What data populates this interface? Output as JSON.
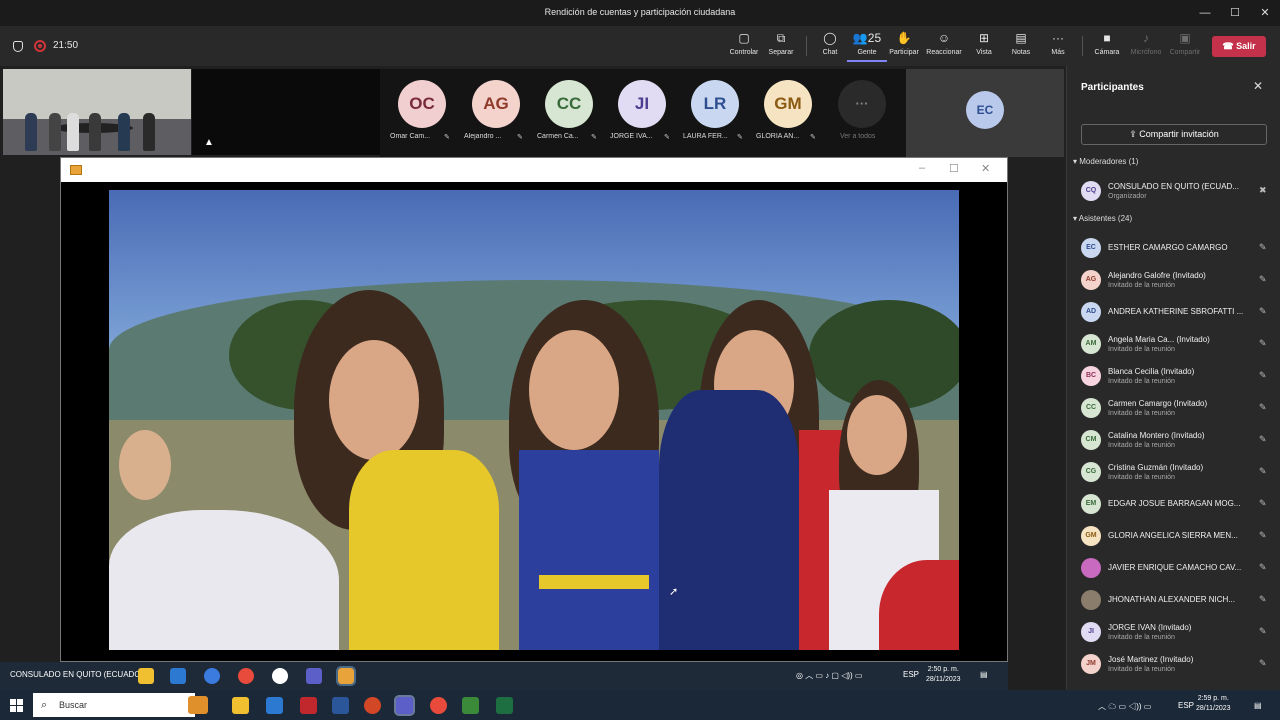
{
  "window": {
    "title": "Rendición de cuentas y participación ciudadana",
    "controls": [
      "—",
      "☐",
      "✕"
    ]
  },
  "meeting": {
    "timer": "21:50",
    "toolbar": [
      {
        "id": "controlar",
        "icon": "▢",
        "label": "Controlar"
      },
      {
        "id": "separar",
        "icon": "⧉",
        "label": "Separar"
      },
      {
        "id": "chat",
        "icon": "◯",
        "label": "Chat"
      },
      {
        "id": "gente",
        "icon": "👥25",
        "label": "Gente"
      },
      {
        "id": "participar",
        "icon": "✋",
        "label": "Participar"
      },
      {
        "id": "reaccionar",
        "icon": "☺",
        "label": "Reaccionar"
      },
      {
        "id": "vista",
        "icon": "⊞",
        "label": "Vista"
      },
      {
        "id": "notas",
        "icon": "▤",
        "label": "Notas"
      },
      {
        "id": "mas",
        "icon": "···",
        "label": "Más"
      },
      {
        "id": "camara",
        "icon": "■",
        "label": "Cámara"
      },
      {
        "id": "microfono",
        "icon": "♪",
        "label": "Micrófono"
      },
      {
        "id": "compartir",
        "icon": "▣",
        "label": "Compartir"
      }
    ],
    "leave_label": "Salir",
    "people_count": "25"
  },
  "stage": {
    "avatars": [
      {
        "initials": "OC",
        "name": "Omar Cam...",
        "bg": "#f1cfd0",
        "fg": "#7a2b3a"
      },
      {
        "initials": "AG",
        "name": "Alejandro ...",
        "bg": "#f4d3cc",
        "fg": "#8f3a2a"
      },
      {
        "initials": "CC",
        "name": "Carmen Ca...",
        "bg": "#d6e6d2",
        "fg": "#3a6b3a"
      },
      {
        "initials": "JI",
        "name": "JORGE IVA...",
        "bg": "#e1dcf3",
        "fg": "#4e3e8f"
      },
      {
        "initials": "LR",
        "name": "LAURA FER...",
        "bg": "#c9d8f0",
        "fg": "#2e4e8f"
      },
      {
        "initials": "GM",
        "name": "GLORIA AN...",
        "bg": "#f6e3c2",
        "fg": "#8a5a12"
      }
    ],
    "more_label": "Ver a todos",
    "more_icon": "···",
    "spotlight_initials": "EC",
    "shared_taskbar_label": "CONSULADO EN QUITO (ECUADOR)",
    "shared_time": "2:50 p. m.",
    "shared_date": "28/11/2023",
    "shared_lang": "ESP"
  },
  "panel": {
    "title": "Participantes",
    "invite_label": "Compartir invitación",
    "moderators_header": "Moderadores (1)",
    "attendees_header": "Asistentes (24)",
    "moderators": [
      {
        "initials": "CQ",
        "name": "CONSULADO EN QUITO (ECUAD...",
        "sub": "Organizador",
        "bg": "#e1dcf3",
        "fg": "#4e3e8f"
      }
    ],
    "attendees": [
      {
        "initials": "EC",
        "name": "ESTHER CAMARGO CAMARGO",
        "sub": "",
        "bg": "#c9d8f0",
        "fg": "#2e4e8f"
      },
      {
        "initials": "AG",
        "name": "Alejandro Galofre (Invitado)",
        "sub": "Invitado de la reunión",
        "bg": "#f4d3cc",
        "fg": "#8f3a2a"
      },
      {
        "initials": "AD",
        "name": "ANDREA KATHERINE SBROFATTI ...",
        "sub": "",
        "bg": "#c9d8f0",
        "fg": "#2e4e8f"
      },
      {
        "initials": "AM",
        "name": "Angela Maria Ca... (Invitado)",
        "sub": "Invitado de la reunión",
        "bg": "#d6e6d2",
        "fg": "#3a6b3a"
      },
      {
        "initials": "BC",
        "name": "Blanca Cecilia (Invitado)",
        "sub": "Invitado de la reunión",
        "bg": "#f6d5e0",
        "fg": "#8f2e55"
      },
      {
        "initials": "CC",
        "name": "Carmen Camargo (Invitado)",
        "sub": "Invitado de la reunión",
        "bg": "#d6e6d2",
        "fg": "#3a6b3a"
      },
      {
        "initials": "CM",
        "name": "Catalina Montero (Invitado)",
        "sub": "Invitado de la reunión",
        "bg": "#d6e6d2",
        "fg": "#3a6b3a"
      },
      {
        "initials": "CG",
        "name": "Cristina Guzmán (Invitado)",
        "sub": "Invitado de la reunión",
        "bg": "#d6e6d2",
        "fg": "#3a6b3a"
      },
      {
        "initials": "EM",
        "name": "EDGAR JOSUE BARRAGAN MOG...",
        "sub": "",
        "bg": "#d6e6d2",
        "fg": "#3a6b3a"
      },
      {
        "initials": "GM",
        "name": "GLORIA ANGELICA SIERRA MEN...",
        "sub": "",
        "bg": "#f6e3c2",
        "fg": "#8a5a12"
      },
      {
        "initials": "",
        "name": "JAVIER ENRIQUE CAMACHO CAV...",
        "sub": "",
        "bg": "#c86ac0",
        "fg": "#ffffff"
      },
      {
        "initials": "",
        "name": "JHONATHAN ALEXANDER NICH...",
        "sub": "",
        "bg": "#8a7d6c",
        "fg": "#ffffff"
      },
      {
        "initials": "JI",
        "name": "JORGE IVAN (Invitado)",
        "sub": "Invitado de la reunión",
        "bg": "#e1dcf3",
        "fg": "#4e3e8f"
      },
      {
        "initials": "JM",
        "name": "José Martinez (Invitado)",
        "sub": "Invitado de la reunión",
        "bg": "#f4d3cc",
        "fg": "#8f3a2a"
      }
    ]
  },
  "windows_taskbar": {
    "search_placeholder": "Buscar",
    "lang": "ESP",
    "time": "2:59 p. m.",
    "date": "28/11/2023"
  }
}
